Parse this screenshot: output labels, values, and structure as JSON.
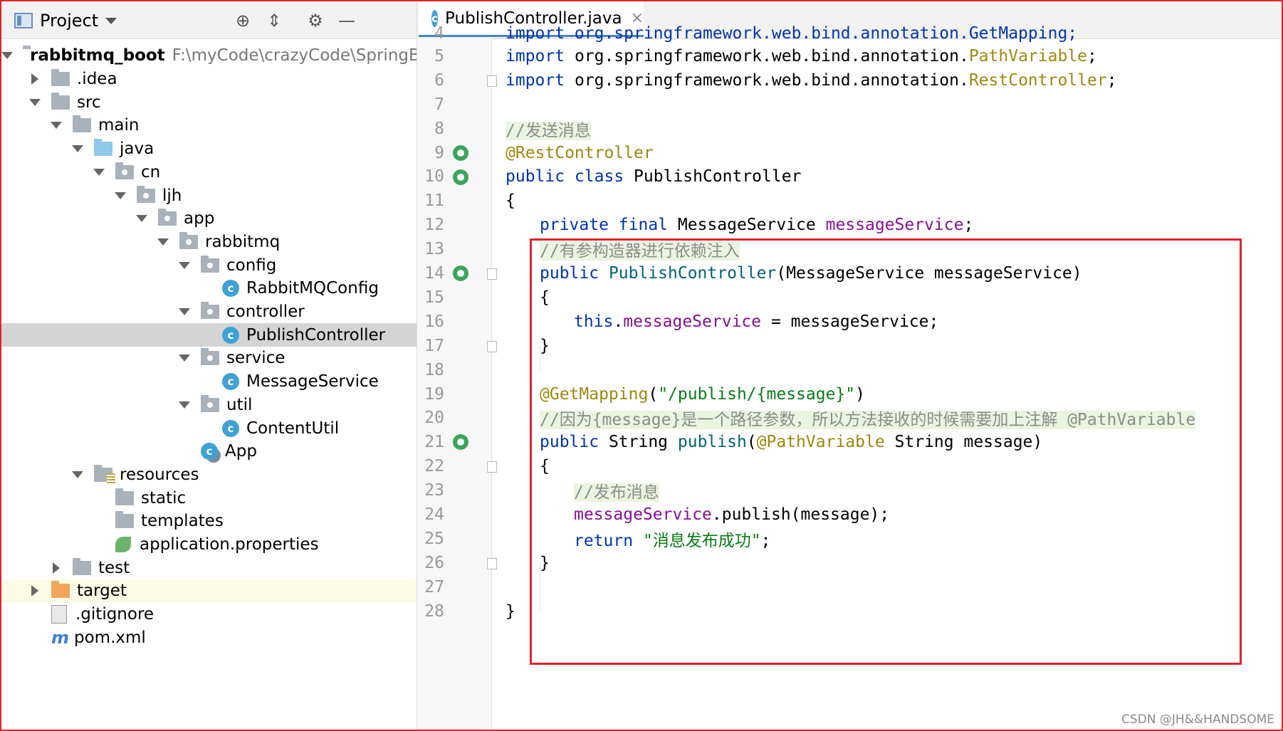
{
  "project_panel": {
    "title": "Project",
    "tree": [
      {
        "label": "rabbitmq_boot",
        "path": "F:\\myCode\\crazyCode\\SpringBo",
        "icon": "module-folder-icon",
        "depth": 0,
        "expanded": true,
        "bold": true
      },
      {
        "label": ".idea",
        "icon": "folder-icon",
        "depth": 1,
        "expanded": false
      },
      {
        "label": "src",
        "icon": "folder-icon",
        "depth": 1,
        "expanded": true
      },
      {
        "label": "main",
        "icon": "folder-icon",
        "depth": 2,
        "expanded": true
      },
      {
        "label": "java",
        "icon": "source-folder-icon",
        "depth": 3,
        "expanded": true
      },
      {
        "label": "cn",
        "icon": "package-icon",
        "depth": 4,
        "expanded": true
      },
      {
        "label": "ljh",
        "icon": "package-icon",
        "depth": 5,
        "expanded": true
      },
      {
        "label": "app",
        "icon": "package-icon",
        "depth": 6,
        "expanded": true
      },
      {
        "label": "rabbitmq",
        "icon": "package-icon",
        "depth": 7,
        "expanded": true
      },
      {
        "label": "config",
        "icon": "package-icon",
        "depth": 8,
        "expanded": true
      },
      {
        "label": "RabbitMQConfig",
        "icon": "java-class-icon",
        "depth": 9
      },
      {
        "label": "controller",
        "icon": "package-icon",
        "depth": 8,
        "expanded": true
      },
      {
        "label": "PublishController",
        "icon": "java-class-icon",
        "depth": 9,
        "selected": true
      },
      {
        "label": "service",
        "icon": "package-icon",
        "depth": 8,
        "expanded": true
      },
      {
        "label": "MessageService",
        "icon": "java-class-icon",
        "depth": 9
      },
      {
        "label": "util",
        "icon": "package-icon",
        "depth": 8,
        "expanded": true
      },
      {
        "label": "ContentUtil",
        "icon": "java-class-icon",
        "depth": 9
      },
      {
        "label": "App",
        "icon": "spring-boot-app-icon",
        "depth": 8
      },
      {
        "label": "resources",
        "icon": "resources-folder-icon",
        "depth": 3,
        "expanded": true
      },
      {
        "label": "static",
        "icon": "folder-icon",
        "depth": 4
      },
      {
        "label": "templates",
        "icon": "folder-icon",
        "depth": 4
      },
      {
        "label": "application.properties",
        "icon": "spring-properties-icon",
        "depth": 4
      },
      {
        "label": "test",
        "icon": "folder-icon",
        "depth": 2,
        "expanded": false
      },
      {
        "label": "target",
        "icon": "excluded-folder-icon",
        "depth": 1,
        "expanded": false,
        "highlight": true
      },
      {
        "label": ".gitignore",
        "icon": "gitignore-file-icon",
        "depth": 1
      },
      {
        "label": "pom.xml",
        "icon": "maven-icon",
        "depth": 1
      }
    ]
  },
  "editor": {
    "tab_label": "PublishController.java",
    "lines": [
      {
        "n": "5",
        "segs": [
          [
            "kw",
            "import "
          ],
          [
            "",
            "org.springframework.web.bind.annotation."
          ],
          [
            "ann",
            "PathVariable"
          ],
          [
            "",
            ";"
          ]
        ]
      },
      {
        "n": "6",
        "segs": [
          [
            "kw",
            "import "
          ],
          [
            "",
            "org.springframework.web.bind.annotation."
          ],
          [
            "ann",
            "RestController"
          ],
          [
            "",
            ";"
          ]
        ],
        "fold": true
      },
      {
        "n": "7",
        "segs": []
      },
      {
        "n": "8",
        "segs": [
          [
            "cmt",
            "//发送消息"
          ]
        ]
      },
      {
        "n": "9",
        "segs": [
          [
            "ann",
            "@RestController"
          ]
        ],
        "gutter": "bean"
      },
      {
        "n": "10",
        "segs": [
          [
            "kw",
            "public class "
          ],
          [
            "",
            "PublishController"
          ]
        ],
        "gutter": "bean"
      },
      {
        "n": "11",
        "segs": [
          [
            "",
            "{"
          ]
        ]
      },
      {
        "n": "12",
        "indent": 1,
        "segs": [
          [
            "kw",
            "private final "
          ],
          [
            "",
            "MessageService "
          ],
          [
            "fld",
            "messageService"
          ],
          [
            "",
            ";"
          ]
        ]
      },
      {
        "n": "13",
        "indent": 1,
        "segs": [
          [
            "cmt",
            "//有参构造器进行依赖注入"
          ]
        ]
      },
      {
        "n": "14",
        "indent": 1,
        "segs": [
          [
            "kw",
            "public "
          ],
          [
            "mth",
            "PublishController"
          ],
          [
            "",
            "(MessageService messageService)"
          ]
        ],
        "gutter": "bean",
        "fold": true
      },
      {
        "n": "15",
        "indent": 1,
        "segs": [
          [
            "",
            "{"
          ]
        ]
      },
      {
        "n": "16",
        "indent": 2,
        "segs": [
          [
            "kw",
            "this"
          ],
          [
            "",
            "."
          ],
          [
            "fld",
            "messageService"
          ],
          [
            "",
            " = messageService;"
          ]
        ]
      },
      {
        "n": "17",
        "indent": 1,
        "segs": [
          [
            "",
            "}"
          ]
        ],
        "fold": true
      },
      {
        "n": "18",
        "segs": []
      },
      {
        "n": "19",
        "indent": 1,
        "segs": [
          [
            "ann",
            "@GetMapping"
          ],
          [
            "",
            "("
          ],
          [
            "str",
            "\"/publish/{message}\""
          ],
          [
            "",
            ")"
          ]
        ]
      },
      {
        "n": "20",
        "indent": 1,
        "segs": [
          [
            "cmt",
            "//因为{message}是一个路径参数，所以方法接收的时候需要加上注解 @PathVariable"
          ]
        ]
      },
      {
        "n": "21",
        "indent": 1,
        "segs": [
          [
            "kw",
            "public "
          ],
          [
            "",
            "String "
          ],
          [
            "mth",
            "publish"
          ],
          [
            "",
            "("
          ],
          [
            "ann",
            "@PathVariable "
          ],
          [
            "",
            "String message)"
          ]
        ],
        "gutter": "web"
      },
      {
        "n": "22",
        "indent": 1,
        "segs": [
          [
            "",
            "{"
          ]
        ],
        "fold": true
      },
      {
        "n": "23",
        "indent": 2,
        "segs": [
          [
            "cmt",
            "//发布消息"
          ]
        ]
      },
      {
        "n": "24",
        "indent": 2,
        "segs": [
          [
            "fld",
            "messageService"
          ],
          [
            "",
            ".publish(message);"
          ]
        ]
      },
      {
        "n": "25",
        "indent": 2,
        "segs": [
          [
            "kw",
            "return "
          ],
          [
            "str",
            "\"消息发布成功\""
          ],
          [
            "",
            ";"
          ]
        ]
      },
      {
        "n": "26",
        "indent": 1,
        "segs": [
          [
            "",
            "}"
          ]
        ],
        "fold": true
      },
      {
        "n": "27",
        "segs": []
      },
      {
        "n": "28",
        "segs": [
          [
            "",
            "}"
          ]
        ]
      }
    ]
  },
  "watermark": "CSDN @JH&&HANDSOME",
  "colors": {
    "highlight_box": "#e0232b",
    "selection": "#d4d4d4",
    "accent_tab": "#4a83c6"
  }
}
